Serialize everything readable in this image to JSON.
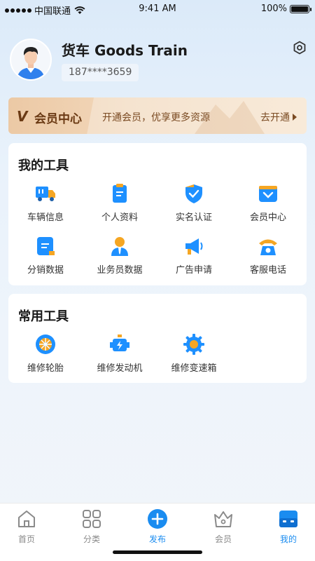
{
  "status": {
    "carrier": "中国联通",
    "time": "9:41 AM",
    "battery": "100%"
  },
  "profile": {
    "name": "货车 Goods Train",
    "phone": "187****3659"
  },
  "member_banner": {
    "title": "会员中心",
    "description": "开通会员，优享更多资源",
    "action": "去开通"
  },
  "my_tools": {
    "title": "我的工具",
    "items": [
      {
        "label": "车辆信息",
        "icon": "truck-icon"
      },
      {
        "label": "个人资料",
        "icon": "clipboard-icon"
      },
      {
        "label": "实名认证",
        "icon": "shield-check-icon"
      },
      {
        "label": "会员中心",
        "icon": "member-crown-icon"
      },
      {
        "label": "分销数据",
        "icon": "document-data-icon"
      },
      {
        "label": "业务员数据",
        "icon": "salesperson-icon"
      },
      {
        "label": "广告申请",
        "icon": "megaphone-icon"
      },
      {
        "label": "客服电话",
        "icon": "telephone-icon"
      }
    ]
  },
  "common_tools": {
    "title": "常用工具",
    "items": [
      {
        "label": "维修轮胎",
        "icon": "tire-icon"
      },
      {
        "label": "维修发动机",
        "icon": "engine-icon"
      },
      {
        "label": "维修变速箱",
        "icon": "gearbox-icon"
      }
    ]
  },
  "tabbar": {
    "items": [
      {
        "label": "首页",
        "icon": "home-icon"
      },
      {
        "label": "分类",
        "icon": "grid-icon"
      },
      {
        "label": "发布",
        "icon": "plus-circle-icon"
      },
      {
        "label": "会员",
        "icon": "crown-icon"
      },
      {
        "label": "我的",
        "icon": "profile-icon"
      }
    ],
    "active_index": 4
  },
  "colors": {
    "accent": "#1a8cf0",
    "member_brown": "#6b3a14",
    "icon_blue": "#1e90ff",
    "icon_orange": "#f5a623"
  }
}
